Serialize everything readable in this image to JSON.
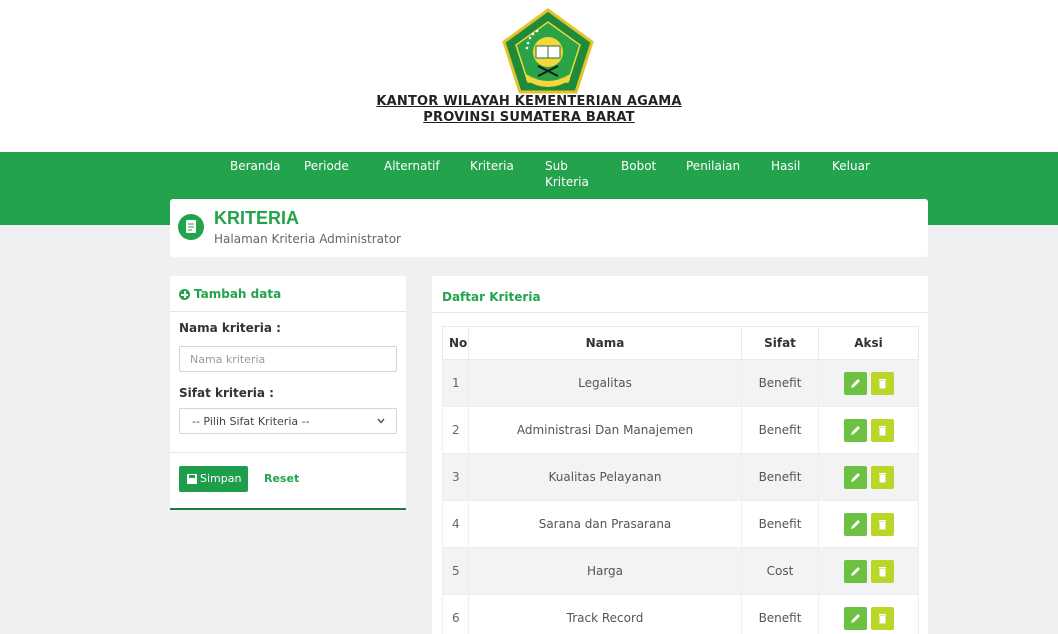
{
  "colors": {
    "brand_green": "#22a34c",
    "edit_button": "#6cc142",
    "delete_button": "#b9d629"
  },
  "office": {
    "line1": "KANTOR WILAYAH KEMENTERIAN AGAMA",
    "line2": "PROVINSI SUMATERA BARAT"
  },
  "nav": {
    "items": [
      {
        "label": "Beranda"
      },
      {
        "label": "Periode"
      },
      {
        "label": "Alternatif"
      },
      {
        "label": "Kriteria"
      },
      {
        "label": "Sub\nKriteria"
      },
      {
        "label": "Bobot"
      },
      {
        "label": "Penilaian"
      },
      {
        "label": "Hasil"
      },
      {
        "label": "Keluar"
      }
    ]
  },
  "page_header": {
    "title": "KRITERIA",
    "subtitle": "Halaman Kriteria Administrator",
    "icon": "document-icon"
  },
  "form": {
    "heading": "Tambah data",
    "name_label": "Nama kriteria :",
    "name_placeholder": "Nama kriteria",
    "name_value": "",
    "type_label": "Sifat kriteria :",
    "type_selected": "-- Pilih Sifat Kriteria --",
    "save_label": "Simpan",
    "reset_label": "Reset"
  },
  "list": {
    "heading": "Daftar Kriteria",
    "columns": [
      "No",
      "Nama",
      "Sifat",
      "Aksi"
    ],
    "rows": [
      {
        "no": "1",
        "nama": "Legalitas",
        "sifat": "Benefit"
      },
      {
        "no": "2",
        "nama": "Administrasi Dan Manajemen",
        "sifat": "Benefit"
      },
      {
        "no": "3",
        "nama": "Kualitas Pelayanan",
        "sifat": "Benefit"
      },
      {
        "no": "4",
        "nama": "Sarana dan Prasarana",
        "sifat": "Benefit"
      },
      {
        "no": "5",
        "nama": "Harga",
        "sifat": "Cost"
      },
      {
        "no": "6",
        "nama": "Track Record",
        "sifat": "Benefit"
      }
    ],
    "actions": {
      "edit_icon": "pencil-icon",
      "delete_icon": "trash-icon"
    }
  }
}
